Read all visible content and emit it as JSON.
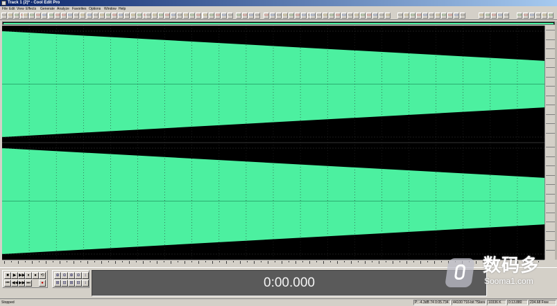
{
  "window": {
    "title": "Track 1 (2)* - Cool Edit Pro"
  },
  "menu": [
    "File",
    "Edit",
    "View",
    "Effects",
    "Generate",
    "Analyze",
    "Favorites",
    "Options",
    "Window",
    "Help"
  ],
  "toolbar_glyphs": [
    "▭",
    "▭",
    "▭",
    "▭",
    "▭",
    "▭",
    "▭",
    "▭",
    "▭",
    "▭",
    "▭",
    "▭",
    "▭",
    "▭",
    "▭",
    "▭",
    "▭",
    "▭",
    "▭",
    "▭",
    "▭",
    "▭",
    "▭",
    "▭",
    "▭",
    "▭",
    "▭",
    "▭",
    "▭",
    "▭",
    "▭",
    "▭",
    "▭",
    "▭",
    "▭",
    "▭",
    "▭",
    "▭",
    "▭",
    "▭",
    "▭",
    "▭",
    "▭",
    "▭",
    "▭",
    "▭",
    "▭",
    "▭",
    "▭",
    "▭",
    "▭",
    "▭",
    "▭",
    "▭",
    "▭",
    "▭",
    "▭",
    "▭",
    "▭",
    "▭",
    "▭",
    "▭",
    "▭",
    "▭",
    "▭",
    "▭",
    "▭",
    "▭",
    "▭",
    "▭",
    "▭"
  ],
  "waveform": {
    "color": "#4cf0a0",
    "background": "#000000",
    "channels": 2,
    "start_level": 1.0,
    "end_level": 0.44
  },
  "transport": {
    "row1": [
      "■",
      "▶",
      "▶▶",
      "⏸",
      "●",
      "⟲"
    ],
    "row2": [
      "⏮",
      "◀◀",
      "▶▶",
      "⏭",
      "●"
    ],
    "zoom_row1": [
      "⊕",
      "⊖",
      "⊕",
      "⊖"
    ],
    "zoom_row2": [
      "⊞",
      "⊟",
      "⊞",
      "⊟"
    ],
    "extra": [
      "↕",
      "↕"
    ],
    "time": "0:00.000"
  },
  "watermark": {
    "cn": "数码多",
    "en": "Sooma1.com"
  },
  "status": {
    "ready": "Stopped",
    "fields": [
      "P: -4.3dB 74 0:05.734",
      "44100 ?16-bit ?Stereo",
      "10336 K",
      "0:13.880",
      "234.68 Free"
    ]
  },
  "colors": {
    "wave": "#4cf0a0",
    "face": "#d4d0c8",
    "display": "#5a5a5a"
  }
}
